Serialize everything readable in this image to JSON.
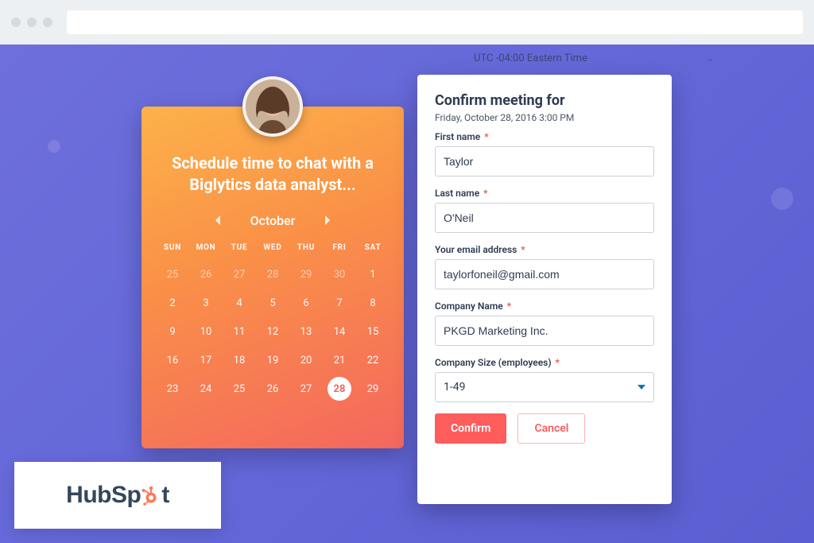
{
  "timezone": {
    "label": "UTC -04:00 Eastern Time"
  },
  "calendar": {
    "headline": "Schedule time to chat with a Biglytics data analyst...",
    "month": "October",
    "dow": [
      "SUN",
      "MON",
      "TUE",
      "WED",
      "THU",
      "FRI",
      "SAT"
    ],
    "weeks": [
      [
        {
          "n": "25",
          "in": false
        },
        {
          "n": "26",
          "in": false
        },
        {
          "n": "27",
          "in": false
        },
        {
          "n": "28",
          "in": false
        },
        {
          "n": "29",
          "in": false
        },
        {
          "n": "30",
          "in": false
        },
        {
          "n": "1",
          "in": true
        }
      ],
      [
        {
          "n": "2",
          "in": true
        },
        {
          "n": "3",
          "in": true
        },
        {
          "n": "4",
          "in": true
        },
        {
          "n": "5",
          "in": true
        },
        {
          "n": "6",
          "in": true
        },
        {
          "n": "7",
          "in": true
        },
        {
          "n": "8",
          "in": true
        }
      ],
      [
        {
          "n": "9",
          "in": true
        },
        {
          "n": "10",
          "in": true
        },
        {
          "n": "11",
          "in": true
        },
        {
          "n": "12",
          "in": true
        },
        {
          "n": "13",
          "in": true
        },
        {
          "n": "14",
          "in": true
        },
        {
          "n": "15",
          "in": true
        }
      ],
      [
        {
          "n": "16",
          "in": true
        },
        {
          "n": "17",
          "in": true
        },
        {
          "n": "18",
          "in": true
        },
        {
          "n": "19",
          "in": true
        },
        {
          "n": "20",
          "in": true
        },
        {
          "n": "21",
          "in": true
        },
        {
          "n": "22",
          "in": true
        }
      ],
      [
        {
          "n": "23",
          "in": true
        },
        {
          "n": "24",
          "in": true
        },
        {
          "n": "25",
          "in": true
        },
        {
          "n": "26",
          "in": true
        },
        {
          "n": "27",
          "in": true
        },
        {
          "n": "28",
          "in": true,
          "selected": true
        },
        {
          "n": "29",
          "in": true
        }
      ]
    ]
  },
  "form": {
    "title": "Confirm meeting for",
    "datetime": "Friday, October 28, 2016 3:00 PM",
    "fields": {
      "first_name": {
        "label": "First name",
        "value": "Taylor"
      },
      "last_name": {
        "label": "Last name",
        "value": "O'Neil"
      },
      "email": {
        "label": "Your email address",
        "value": "taylorfoneil@gmail.com"
      },
      "company": {
        "label": "Company Name",
        "value": "PKGD Marketing Inc."
      },
      "size": {
        "label": "Company Size (employees)",
        "value": "1-49"
      }
    },
    "buttons": {
      "confirm": "Confirm",
      "cancel": "Cancel"
    }
  },
  "logo": {
    "text_before_sprocket": "HubSp",
    "text_after_sprocket": "t"
  }
}
